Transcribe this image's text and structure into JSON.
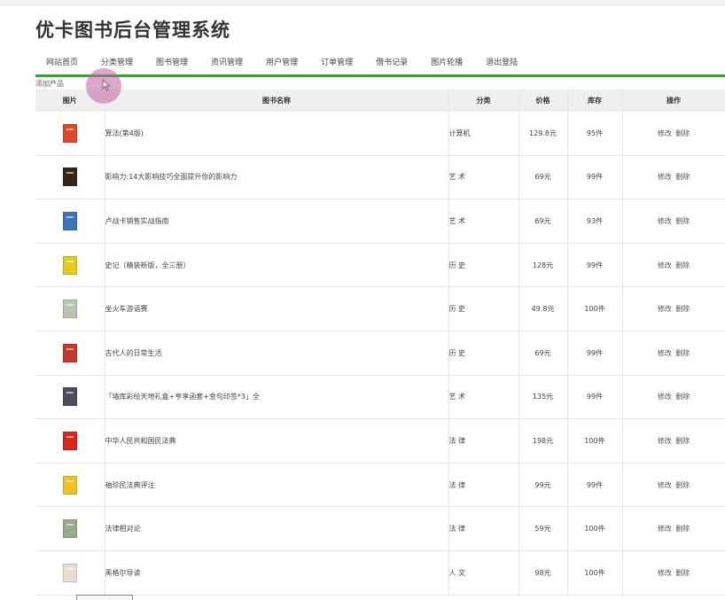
{
  "app": {
    "title": "优卡图书后台管理系统"
  },
  "nav": {
    "items": [
      {
        "id": "home",
        "label": "网站首页"
      },
      {
        "id": "category",
        "label": "分类管理"
      },
      {
        "id": "books",
        "label": "图书管理"
      },
      {
        "id": "news",
        "label": "资讯管理"
      },
      {
        "id": "users",
        "label": "用户管理"
      },
      {
        "id": "orders",
        "label": "订单管理"
      },
      {
        "id": "borrow",
        "label": "借书记录"
      },
      {
        "id": "carousel",
        "label": "图片轮播"
      },
      {
        "id": "logout",
        "label": "退出登陆"
      }
    ]
  },
  "toolbar": {
    "add_label": "添加产品"
  },
  "table": {
    "headers": [
      "图片",
      "图书名称",
      "分类",
      "价格",
      "库存",
      "操作"
    ],
    "edit_label": "修改",
    "delete_label": "删除",
    "rows": [
      {
        "name": "算法(第4版)",
        "category": "计算机",
        "price": "129.8元",
        "stock": "95件",
        "cover": "#e0482b"
      },
      {
        "name": "影响力:14大影响技巧全面提升你的影响力",
        "category": "艺 术",
        "price": "69元",
        "stock": "99件",
        "cover": "#3a2416"
      },
      {
        "name": "卢战卡销售实战指南",
        "category": "艺 术",
        "price": "69元",
        "stock": "93件",
        "cover": "#3c74b8"
      },
      {
        "name": "史记（精装新版，全三册）",
        "category": "历 史",
        "price": "128元",
        "stock": "99件",
        "cover": "#e4cc1e"
      },
      {
        "name": "坐火车游语赛",
        "category": "历 史",
        "price": "49.8元",
        "stock": "100件",
        "cover": "#b6c6b0"
      },
      {
        "name": "古代人的日常生活",
        "category": "历 史",
        "price": "69元",
        "stock": "99件",
        "cover": "#c3392a"
      },
      {
        "name": "「墙库彩绘天地礼盒+亨享函套+金句印签*3」全",
        "category": "艺 术",
        "price": "135元",
        "stock": "99件",
        "cover": "#4a4f5c"
      },
      {
        "name": "中华人民共和国民法典",
        "category": "法 律",
        "price": "198元",
        "stock": "100件",
        "cover": "#d8261d"
      },
      {
        "name": "袖珍民法典评注",
        "category": "法 律",
        "price": "99元",
        "stock": "99件",
        "cover": "#ecc428"
      },
      {
        "name": "法律相对论",
        "category": "法 律",
        "price": "59元",
        "stock": "100件",
        "cover": "#9aa88e"
      },
      {
        "name": "黑格尔导读",
        "category": "人 文",
        "price": "98元",
        "stock": "100件",
        "cover": "#e9ddd2"
      }
    ]
  }
}
